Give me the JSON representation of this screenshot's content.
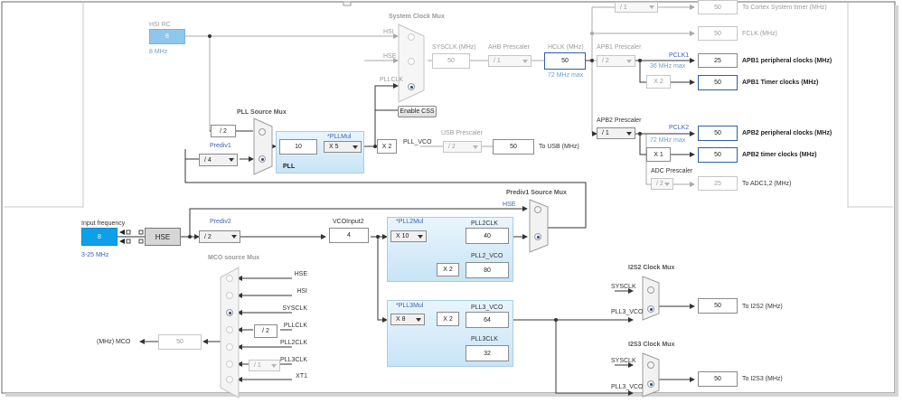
{
  "top": {
    "hsi_rc_label": "HSI RC",
    "hsi_value": "8",
    "hsi_unit": "8 MHz",
    "system_clock_mux": "System Clock Mux",
    "mux_hsi": "HSI",
    "mux_hse": "HSE",
    "mux_pllclk": "PLLCLK",
    "enable_css": "Enable CSS",
    "sysclk_label": "SYSCLK (MHz)",
    "sysclk_value": "50",
    "ahb_prescaler_label": "AHB Prescaler",
    "ahb_prescaler_value": "/ 1",
    "hclk_label": "HCLK (MHz)",
    "hclk_value": "50",
    "hclk_max": "72 MHz max",
    "cortex_div": "/ 1",
    "cortex_value": "50",
    "cortex_label": "To Cortex System timer (MHz)",
    "fclk_value": "50",
    "fclk_label": "FCLK (MHz)"
  },
  "apb1": {
    "prescaler_label": "APB1 Prescaler",
    "prescaler_value": "/ 2",
    "pclk1_label": "PCLK1",
    "pclk1_max": "36 MHz max",
    "periph_value": "25",
    "periph_label": "APB1 peripheral clocks (MHz)",
    "timer_mult": "X 2",
    "timer_value": "50",
    "timer_label": "APB1 Timer clocks (MHz)"
  },
  "apb2": {
    "prescaler_label": "APB2 Prescaler",
    "prescaler_value": "/ 1",
    "pclk2_label": "PCLK2",
    "pclk2_max": "72 MHz max",
    "periph_value": "50",
    "periph_label": "APB2 peripheral clocks (MHz)",
    "timer_mult": "X 1",
    "timer_value": "50",
    "timer_label": "APB2 timer clocks (MHz)",
    "adc_prescaler_label": "ADC Prescaler",
    "adc_prescaler_value": "/ 2",
    "adc_value": "25",
    "adc_label": "To ADC1,2 (MHz)"
  },
  "pll": {
    "source_mux_label": "PLL Source Mux",
    "div2_label": "/ 2",
    "prediv1_label": "Prediv1",
    "prediv1_value": "/ 4",
    "pllmul_label": "*PLLMul",
    "pll_in_value": "10",
    "pllmul_value": "X 5",
    "pll_label": "PLL",
    "x2_label": "X 2",
    "pll_vco_label": "PLL_VCO",
    "usb_prescaler_label": "USB Prescaler",
    "usb_prescaler_value": "/ 2",
    "usb_value": "50",
    "usb_label": "To USB (MHz)"
  },
  "input": {
    "freq_label": "Input frequency",
    "freq_value": "8",
    "freq_range": "3-25 MHz",
    "hse_label": "HSE",
    "prediv2_label": "Prediv2",
    "prediv2_value": "/ 2",
    "vcoinput2_label": "VCOInput2",
    "vcoinput2_value": "4",
    "prediv1_source_mux": "Prediv1 Source Mux",
    "prediv1_mux_hse": "HSE"
  },
  "pll2": {
    "mul_label": "*PLL2Mul",
    "mul_value": "X 10",
    "clk_label": "PLL2CLK",
    "clk_value": "40",
    "x2_label": "X 2",
    "vco_label": "PLL2_VCO",
    "vco_value": "80"
  },
  "pll3": {
    "mul_label": "*PLL3Mul",
    "mul_value": "X 8",
    "x2_label": "X 2",
    "vco_label": "PLL3_VCO",
    "vco_value": "64",
    "clk_label": "PLL3CLK",
    "clk_value": "32"
  },
  "mco": {
    "source_mux_label": "MCO source Mux",
    "inputs": [
      "HSE",
      "HSI",
      "SYSCLK",
      "PLLCLK",
      "PLL2CLK",
      "PLL3CLK",
      "XT1"
    ],
    "pllclk_div": "/ 2",
    "pll3clk_div": "/ 1",
    "output_label": "(MHz) MCO",
    "output_value": "50"
  },
  "i2s2": {
    "mux_label": "I2S2 Clock Mux",
    "sysclk_label": "SYSCLK",
    "pll3_vco_label": "PLL3_VCO",
    "value": "50",
    "out_label": "To I2S2 (MHz)"
  },
  "i2s3": {
    "mux_label": "I2S3 Clock Mux",
    "sysclk_label": "SYSCLK",
    "pll3_vco_label": "PLL3_VCO",
    "value": "50",
    "out_label": "To I2S3 (MHz)"
  }
}
